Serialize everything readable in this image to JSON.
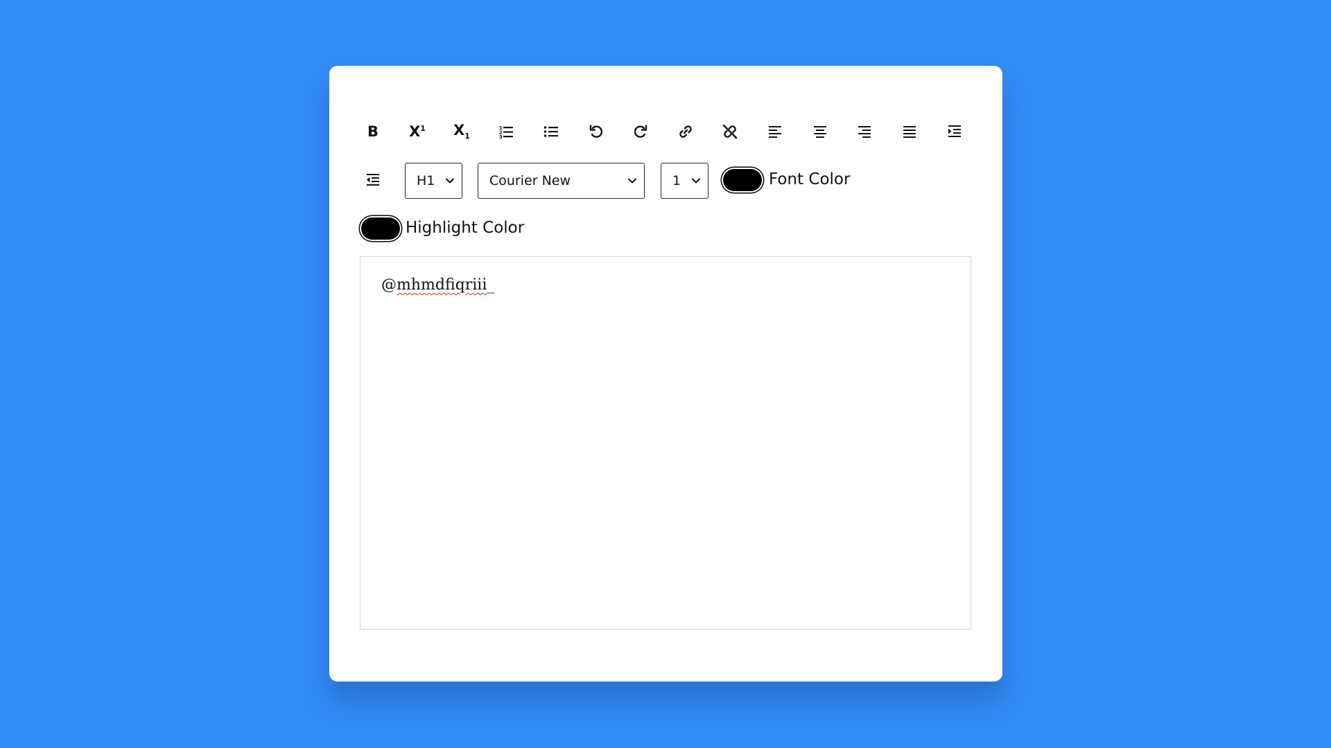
{
  "toolbar": {
    "buttons": [
      {
        "name": "bold-button",
        "icon": "bold-icon"
      },
      {
        "name": "superscript-button",
        "icon": "superscript-icon"
      },
      {
        "name": "subscript-button",
        "icon": "subscript-icon"
      },
      {
        "name": "ordered-list-button",
        "icon": "ordered-list-icon"
      },
      {
        "name": "unordered-list-button",
        "icon": "unordered-list-icon"
      },
      {
        "name": "undo-button",
        "icon": "undo-icon"
      },
      {
        "name": "redo-button",
        "icon": "redo-icon"
      },
      {
        "name": "link-button",
        "icon": "link-icon"
      },
      {
        "name": "unlink-button",
        "icon": "unlink-icon"
      },
      {
        "name": "align-left-button",
        "icon": "align-left-icon"
      },
      {
        "name": "align-center-button",
        "icon": "align-center-icon"
      },
      {
        "name": "align-right-button",
        "icon": "align-right-icon"
      },
      {
        "name": "justify-button",
        "icon": "justify-icon"
      },
      {
        "name": "indent-button",
        "icon": "indent-icon"
      },
      {
        "name": "outdent-button",
        "icon": "outdent-icon"
      }
    ],
    "heading_select": {
      "value": "H1"
    },
    "font_select": {
      "value": "Courier New"
    },
    "size_select": {
      "value": "1"
    },
    "font_color": {
      "label": "Font Color",
      "value": "#000000"
    },
    "highlight_color": {
      "label": "Highlight Color",
      "value": "#000000"
    }
  },
  "editor": {
    "prefix": "@",
    "word": "mhmdfiqriii",
    "suffix": "_"
  },
  "colors": {
    "background": "#338df5",
    "card": "#ffffff",
    "swatch": "#000000"
  }
}
